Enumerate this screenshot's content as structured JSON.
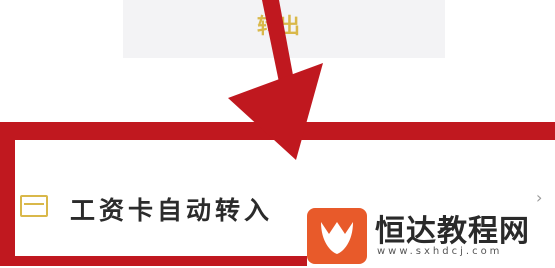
{
  "top_card": {
    "label": "转出"
  },
  "row": {
    "label": "工资卡自动转入",
    "icon": "bank-card-icon",
    "chevron": "›"
  },
  "watermark": {
    "title": "恒达教程网",
    "url": "www.sxhdcj.com"
  },
  "colors": {
    "highlight": "#c0181f",
    "accent": "#d9b84a",
    "logo": "#e85a2a"
  }
}
